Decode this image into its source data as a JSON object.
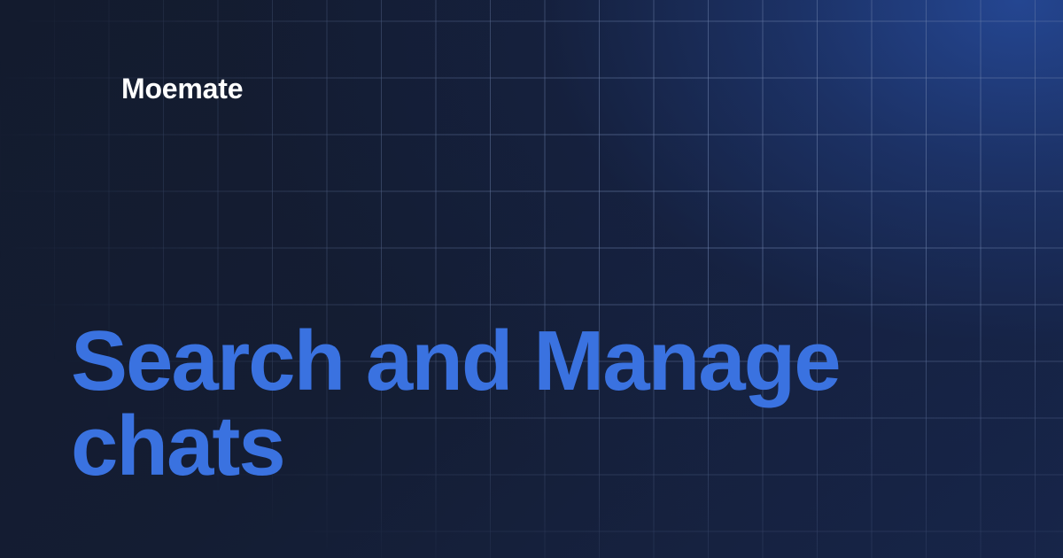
{
  "brand": {
    "name": "Moemate"
  },
  "headline": {
    "line1": "Search and Manage",
    "line2": "chats"
  },
  "colors": {
    "background_dark": "#111827",
    "background_glow": "#254896",
    "grid_line": "#5a6e96",
    "brand_text": "#ffffff",
    "headline_text": "#3a72e0"
  }
}
